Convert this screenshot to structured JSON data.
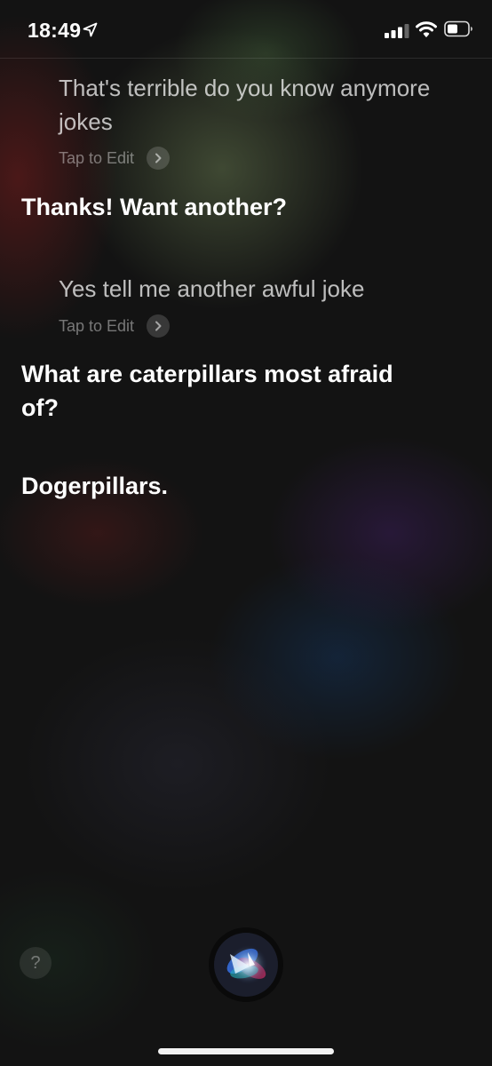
{
  "status_bar": {
    "time": "18:49",
    "icons": [
      "location-arrow-icon",
      "cellular-signal-icon",
      "wifi-icon",
      "battery-icon"
    ]
  },
  "conversation": [
    {
      "type": "user",
      "text": "That's terrible do you know anymore jokes",
      "edit_label": "Tap to Edit"
    },
    {
      "type": "siri",
      "text": "Thanks! Want another?"
    },
    {
      "type": "user",
      "text": "Yes tell me another awful joke",
      "edit_label": "Tap to Edit"
    },
    {
      "type": "siri",
      "text": "What are caterpillars most afraid of?"
    },
    {
      "type": "siri",
      "text": "Dogerpillars."
    }
  ],
  "bottom_bar": {
    "help_label": "?",
    "siri_button_icon": "siri-orb-icon"
  }
}
